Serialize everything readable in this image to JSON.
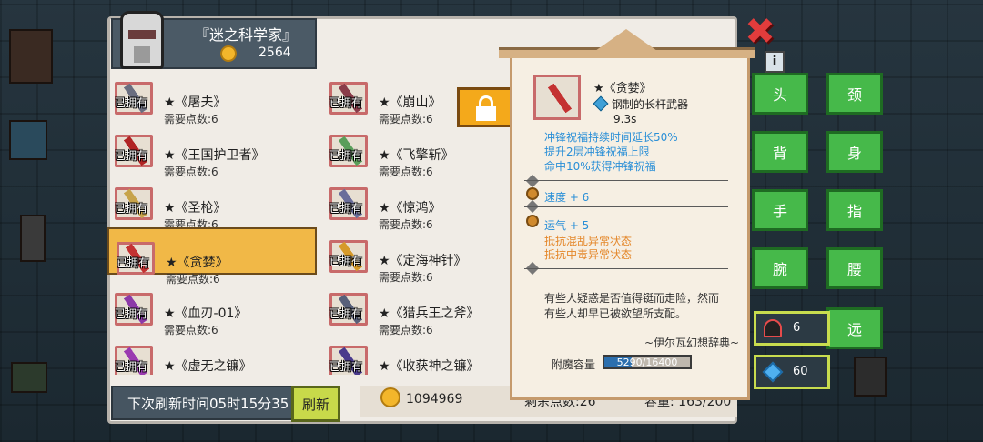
{
  "header": {
    "title": "『迷之科学家』",
    "coins": "2564"
  },
  "list": {
    "owned_label": "已拥有",
    "items": [
      {
        "name": "★《屠夫》",
        "req": "需要点数:6",
        "color": "#6a6e80"
      },
      {
        "name": "★《崩山》",
        "req": "需要点数:6",
        "color": "#8a3c4a"
      },
      {
        "name": "★《王国护卫者》",
        "req": "需要点数:6",
        "color": "#b02424"
      },
      {
        "name": "★《飞擎斩》",
        "req": "需要点数:6",
        "color": "#5a9e5a"
      },
      {
        "name": "★《圣枪》",
        "req": "需要点数:6",
        "color": "#c7a34a"
      },
      {
        "name": "★《惊鸿》",
        "req": "需要点数:6",
        "color": "#6a6e9a"
      },
      {
        "name": "★《贪婪》",
        "req": "需要点数:6",
        "color": "#c43232",
        "selected": true
      },
      {
        "name": "★《定海神针》",
        "req": "需要点数:6",
        "color": "#d69a2a"
      },
      {
        "name": "★《血刃-01》",
        "req": "需要点数:6",
        "color": "#8c3aa8"
      },
      {
        "name": "★《猎兵王之斧》",
        "req": "需要点数:6",
        "color": "#58607a"
      },
      {
        "name": "★《虚无之镰》",
        "req": "",
        "color": "#9a3ab0"
      },
      {
        "name": "★《收获神之镰》",
        "req": "",
        "color": "#4a3a8c"
      }
    ]
  },
  "bottom": {
    "refresh_label": "下次刷新时间05时15分35",
    "refresh_button": "刷新",
    "gold": "1094969",
    "points_left": "剩余点数:26",
    "capacity": "容量: 163/200"
  },
  "detail": {
    "name": "★《贪婪》",
    "type": "钢制的长杆武器",
    "time": "9.3s",
    "effects": [
      "冲锋祝福持续时间延长50%",
      "提升2层冲锋祝福上限",
      "命中10%获得冲锋祝福"
    ],
    "stat_speed": "速度 + 6",
    "stat_luck": "运气 + 5",
    "resist_1": "抵抗混乱异常状态",
    "resist_2": "抵抗中毒异常状态",
    "lore": "有些人疑惑是否值得铤而走险，然而有些人却早已被欲望所支配。",
    "lore_source": "~伊尔瓦幻想辞典~",
    "enchant_label": "附魔容量",
    "enchant_value": "5290/16400",
    "enchant_fraction": 0.3226,
    "weapon_color": "#c43232"
  },
  "equipment": {
    "head": "头",
    "neck": "颈",
    "back": "背",
    "body": "身",
    "hand": "手",
    "finger": "指",
    "wrist": "腕",
    "waist": "腰",
    "ranged": "远"
  },
  "resources": {
    "characters": "6",
    "gems": "60"
  },
  "controls": {
    "close": "✖",
    "info": "i"
  },
  "colors": {
    "panel": "#f0ece6",
    "selected": "#f1b847",
    "equip_button": "#46b94a",
    "close": "#e23c3c",
    "effect_blue": "#2a8fd7",
    "effect_orange": "#e4872a"
  }
}
